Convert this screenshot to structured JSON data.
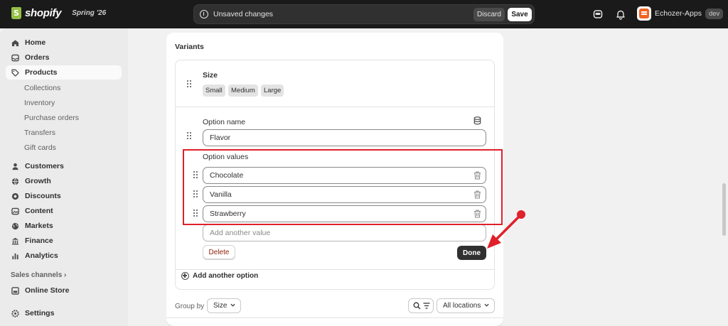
{
  "topbar": {
    "brand": "shopify",
    "edition": "Spring '26",
    "unsaved_text": "Unsaved changes",
    "discard_label": "Discard",
    "save_label": "Save",
    "store_name": "Echozer-Apps",
    "store_badge": "dev"
  },
  "sidebar": {
    "items": [
      {
        "label": "Home",
        "icon": "home-icon"
      },
      {
        "label": "Orders",
        "icon": "inbox-icon"
      },
      {
        "label": "Products",
        "icon": "tag-icon"
      },
      {
        "label": "Customers",
        "icon": "person-icon"
      },
      {
        "label": "Growth",
        "icon": "globe-icon"
      },
      {
        "label": "Discounts",
        "icon": "gear-badge-icon"
      },
      {
        "label": "Content",
        "icon": "image-icon"
      },
      {
        "label": "Markets",
        "icon": "globe-icon"
      },
      {
        "label": "Finance",
        "icon": "bank-icon"
      },
      {
        "label": "Analytics",
        "icon": "bar-chart-icon"
      }
    ],
    "product_subitems": [
      "Collections",
      "Inventory",
      "Purchase orders",
      "Transfers",
      "Gift cards"
    ],
    "sales_channels_label": "Sales channels",
    "sales_channels_chevron": "›",
    "online_store": "Online Store",
    "settings": "Settings"
  },
  "variants": {
    "title": "Variants",
    "size_option": {
      "name": "Size",
      "values": [
        "Small",
        "Medium",
        "Large"
      ]
    },
    "editing_option": {
      "name_label": "Option name",
      "name_value": "Flavor",
      "values_label": "Option values",
      "values": [
        "Chocolate",
        "Vanilla",
        "Strawberry"
      ],
      "add_placeholder": "Add another value",
      "delete_label": "Delete",
      "done_label": "Done"
    },
    "add_option_label": "Add another option",
    "group_by_label": "Group by",
    "group_by_value": "Size",
    "locations_value": "All locations"
  },
  "colors": {
    "annotation": "#e0202a",
    "primary_button": "#303030",
    "destructive_text": "#8e1f0b"
  }
}
